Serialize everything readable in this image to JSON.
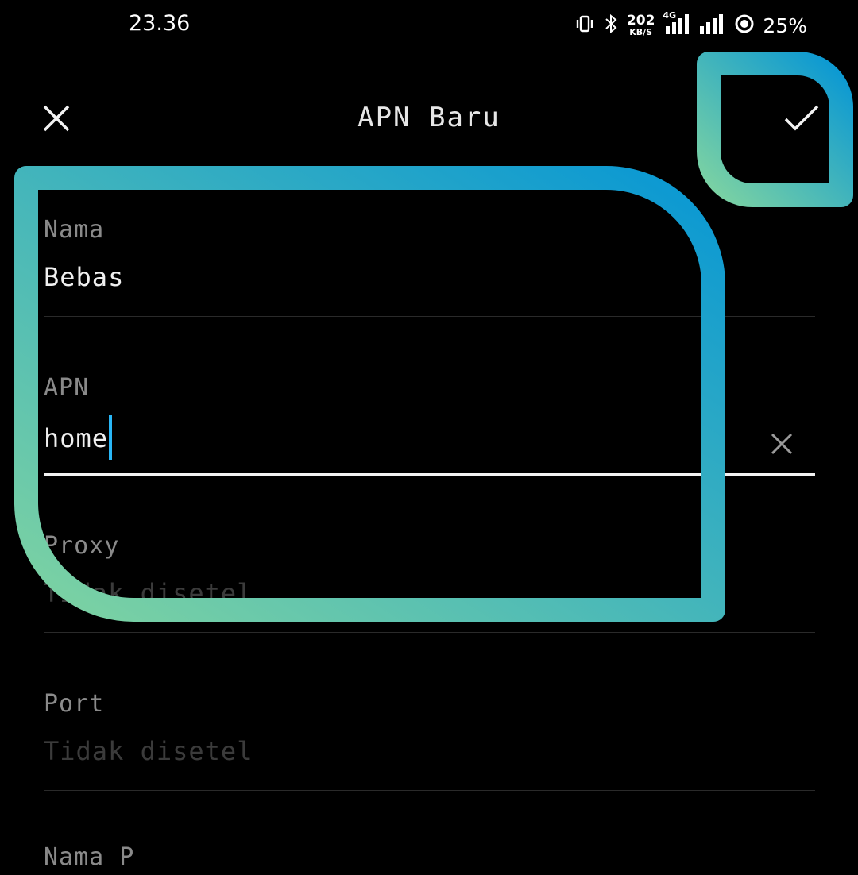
{
  "status_bar": {
    "time": "23.36",
    "speed_value": "202",
    "speed_unit": "KB/S",
    "network_type": "4G",
    "battery": "25%",
    "icons": [
      "vibrate-icon",
      "bluetooth-icon",
      "signal-icon",
      "signal-icon",
      "battery-saver-icon"
    ]
  },
  "toolbar": {
    "title": "APN Baru",
    "close_icon": "close-icon",
    "confirm_icon": "check-icon"
  },
  "fields": {
    "name": {
      "label": "Nama",
      "value": "Bebas"
    },
    "apn": {
      "label": "APN",
      "value": "home"
    },
    "proxy": {
      "label": "Proxy",
      "placeholder": "Tidak disetel"
    },
    "port": {
      "label": "Port",
      "placeholder": "Tidak disetel"
    },
    "next": {
      "label": "Nama P"
    }
  },
  "colors": {
    "cursor": "#29b6f6",
    "highlight_gradient": [
      "#7ed3a2",
      "#0897d4"
    ]
  }
}
